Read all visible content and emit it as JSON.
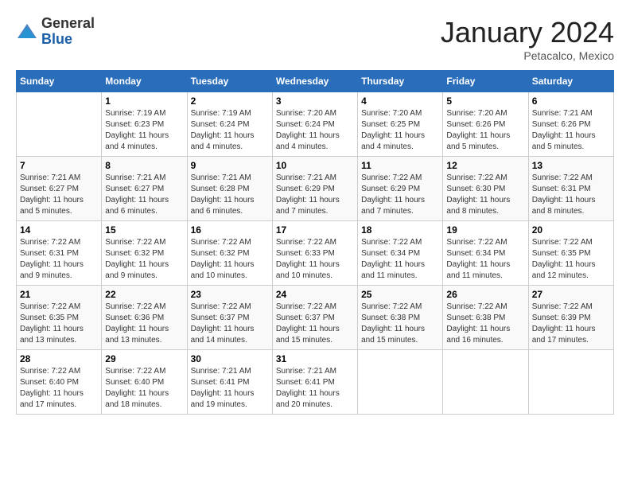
{
  "header": {
    "logo_general": "General",
    "logo_blue": "Blue",
    "month_title": "January 2024",
    "location": "Petacalco, Mexico"
  },
  "days_of_week": [
    "Sunday",
    "Monday",
    "Tuesday",
    "Wednesday",
    "Thursday",
    "Friday",
    "Saturday"
  ],
  "weeks": [
    [
      {
        "day": "",
        "sunrise": "",
        "sunset": "",
        "daylight": ""
      },
      {
        "day": "1",
        "sunrise": "Sunrise: 7:19 AM",
        "sunset": "Sunset: 6:23 PM",
        "daylight": "Daylight: 11 hours and 4 minutes."
      },
      {
        "day": "2",
        "sunrise": "Sunrise: 7:19 AM",
        "sunset": "Sunset: 6:24 PM",
        "daylight": "Daylight: 11 hours and 4 minutes."
      },
      {
        "day": "3",
        "sunrise": "Sunrise: 7:20 AM",
        "sunset": "Sunset: 6:24 PM",
        "daylight": "Daylight: 11 hours and 4 minutes."
      },
      {
        "day": "4",
        "sunrise": "Sunrise: 7:20 AM",
        "sunset": "Sunset: 6:25 PM",
        "daylight": "Daylight: 11 hours and 4 minutes."
      },
      {
        "day": "5",
        "sunrise": "Sunrise: 7:20 AM",
        "sunset": "Sunset: 6:26 PM",
        "daylight": "Daylight: 11 hours and 5 minutes."
      },
      {
        "day": "6",
        "sunrise": "Sunrise: 7:21 AM",
        "sunset": "Sunset: 6:26 PM",
        "daylight": "Daylight: 11 hours and 5 minutes."
      }
    ],
    [
      {
        "day": "7",
        "sunrise": "Sunrise: 7:21 AM",
        "sunset": "Sunset: 6:27 PM",
        "daylight": "Daylight: 11 hours and 5 minutes."
      },
      {
        "day": "8",
        "sunrise": "Sunrise: 7:21 AM",
        "sunset": "Sunset: 6:27 PM",
        "daylight": "Daylight: 11 hours and 6 minutes."
      },
      {
        "day": "9",
        "sunrise": "Sunrise: 7:21 AM",
        "sunset": "Sunset: 6:28 PM",
        "daylight": "Daylight: 11 hours and 6 minutes."
      },
      {
        "day": "10",
        "sunrise": "Sunrise: 7:21 AM",
        "sunset": "Sunset: 6:29 PM",
        "daylight": "Daylight: 11 hours and 7 minutes."
      },
      {
        "day": "11",
        "sunrise": "Sunrise: 7:22 AM",
        "sunset": "Sunset: 6:29 PM",
        "daylight": "Daylight: 11 hours and 7 minutes."
      },
      {
        "day": "12",
        "sunrise": "Sunrise: 7:22 AM",
        "sunset": "Sunset: 6:30 PM",
        "daylight": "Daylight: 11 hours and 8 minutes."
      },
      {
        "day": "13",
        "sunrise": "Sunrise: 7:22 AM",
        "sunset": "Sunset: 6:31 PM",
        "daylight": "Daylight: 11 hours and 8 minutes."
      }
    ],
    [
      {
        "day": "14",
        "sunrise": "Sunrise: 7:22 AM",
        "sunset": "Sunset: 6:31 PM",
        "daylight": "Daylight: 11 hours and 9 minutes."
      },
      {
        "day": "15",
        "sunrise": "Sunrise: 7:22 AM",
        "sunset": "Sunset: 6:32 PM",
        "daylight": "Daylight: 11 hours and 9 minutes."
      },
      {
        "day": "16",
        "sunrise": "Sunrise: 7:22 AM",
        "sunset": "Sunset: 6:32 PM",
        "daylight": "Daylight: 11 hours and 10 minutes."
      },
      {
        "day": "17",
        "sunrise": "Sunrise: 7:22 AM",
        "sunset": "Sunset: 6:33 PM",
        "daylight": "Daylight: 11 hours and 10 minutes."
      },
      {
        "day": "18",
        "sunrise": "Sunrise: 7:22 AM",
        "sunset": "Sunset: 6:34 PM",
        "daylight": "Daylight: 11 hours and 11 minutes."
      },
      {
        "day": "19",
        "sunrise": "Sunrise: 7:22 AM",
        "sunset": "Sunset: 6:34 PM",
        "daylight": "Daylight: 11 hours and 11 minutes."
      },
      {
        "day": "20",
        "sunrise": "Sunrise: 7:22 AM",
        "sunset": "Sunset: 6:35 PM",
        "daylight": "Daylight: 11 hours and 12 minutes."
      }
    ],
    [
      {
        "day": "21",
        "sunrise": "Sunrise: 7:22 AM",
        "sunset": "Sunset: 6:35 PM",
        "daylight": "Daylight: 11 hours and 13 minutes."
      },
      {
        "day": "22",
        "sunrise": "Sunrise: 7:22 AM",
        "sunset": "Sunset: 6:36 PM",
        "daylight": "Daylight: 11 hours and 13 minutes."
      },
      {
        "day": "23",
        "sunrise": "Sunrise: 7:22 AM",
        "sunset": "Sunset: 6:37 PM",
        "daylight": "Daylight: 11 hours and 14 minutes."
      },
      {
        "day": "24",
        "sunrise": "Sunrise: 7:22 AM",
        "sunset": "Sunset: 6:37 PM",
        "daylight": "Daylight: 11 hours and 15 minutes."
      },
      {
        "day": "25",
        "sunrise": "Sunrise: 7:22 AM",
        "sunset": "Sunset: 6:38 PM",
        "daylight": "Daylight: 11 hours and 15 minutes."
      },
      {
        "day": "26",
        "sunrise": "Sunrise: 7:22 AM",
        "sunset": "Sunset: 6:38 PM",
        "daylight": "Daylight: 11 hours and 16 minutes."
      },
      {
        "day": "27",
        "sunrise": "Sunrise: 7:22 AM",
        "sunset": "Sunset: 6:39 PM",
        "daylight": "Daylight: 11 hours and 17 minutes."
      }
    ],
    [
      {
        "day": "28",
        "sunrise": "Sunrise: 7:22 AM",
        "sunset": "Sunset: 6:40 PM",
        "daylight": "Daylight: 11 hours and 17 minutes."
      },
      {
        "day": "29",
        "sunrise": "Sunrise: 7:22 AM",
        "sunset": "Sunset: 6:40 PM",
        "daylight": "Daylight: 11 hours and 18 minutes."
      },
      {
        "day": "30",
        "sunrise": "Sunrise: 7:21 AM",
        "sunset": "Sunset: 6:41 PM",
        "daylight": "Daylight: 11 hours and 19 minutes."
      },
      {
        "day": "31",
        "sunrise": "Sunrise: 7:21 AM",
        "sunset": "Sunset: 6:41 PM",
        "daylight": "Daylight: 11 hours and 20 minutes."
      },
      {
        "day": "",
        "sunrise": "",
        "sunset": "",
        "daylight": ""
      },
      {
        "day": "",
        "sunrise": "",
        "sunset": "",
        "daylight": ""
      },
      {
        "day": "",
        "sunrise": "",
        "sunset": "",
        "daylight": ""
      }
    ]
  ]
}
